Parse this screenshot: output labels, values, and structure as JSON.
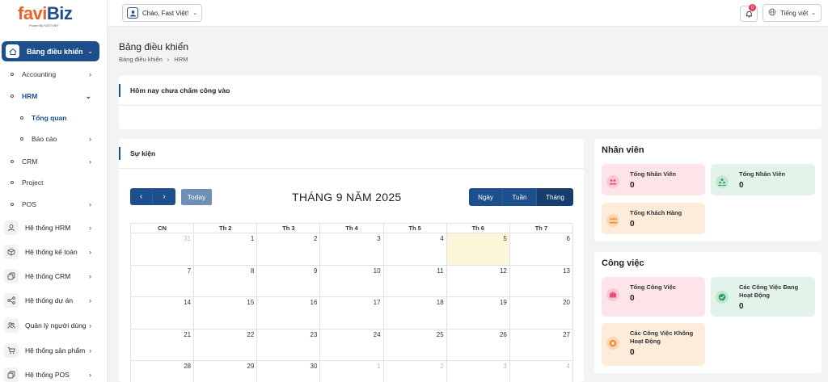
{
  "app": {
    "logo_part1": "favi",
    "logo_part2": "Biz",
    "logo_sub": "Power By FASTVIET"
  },
  "header": {
    "greeting": "Chào, Fast Việt!",
    "notification_count": "0",
    "language": "Tiếng việt"
  },
  "sidebar": {
    "dashboard": "Bảng điều khiển",
    "sub_items": [
      {
        "label": "Accounting"
      },
      {
        "label": "HRM"
      },
      {
        "label": "Tổng quan"
      },
      {
        "label": "Báo cáo"
      },
      {
        "label": "CRM"
      },
      {
        "label": "Project"
      },
      {
        "label": "POS"
      }
    ],
    "systems": [
      {
        "label": "Hệ thống HRM",
        "icon": "user-icon"
      },
      {
        "label": "Hệ thống kế toán",
        "icon": "box-icon"
      },
      {
        "label": "Hệ thống CRM",
        "icon": "copy-icon"
      },
      {
        "label": "Hệ thống dự án",
        "icon": "share-icon"
      },
      {
        "label": "Quản lý người dùng",
        "icon": "users-icon"
      },
      {
        "label": "Hệ thống sản phẩm",
        "icon": "cart-icon"
      },
      {
        "label": "Hệ thống POS",
        "icon": "copy-icon"
      }
    ]
  },
  "page": {
    "title": "Bảng điều khiển",
    "breadcrumb": [
      "Bảng điều khiển",
      "HRM"
    ],
    "checkin_message": "Hôm nay chưa chấm công vào"
  },
  "events": {
    "title": "Sự kiện",
    "today_label": "Today",
    "month_title": "THÁNG 9 NĂM 2025",
    "views": [
      "Ngày",
      "Tuần",
      "Tháng"
    ],
    "active_view": "Tháng",
    "weekdays": [
      "CN",
      "Th 2",
      "Th 3",
      "Th 4",
      "Th 5",
      "Th 6",
      "Th 7"
    ],
    "weeks": [
      [
        "31",
        "1",
        "2",
        "3",
        "4",
        "5",
        "6"
      ],
      [
        "7",
        "8",
        "9",
        "10",
        "11",
        "12",
        "13"
      ],
      [
        "14",
        "15",
        "16",
        "17",
        "18",
        "19",
        "20"
      ],
      [
        "21",
        "22",
        "23",
        "24",
        "25",
        "26",
        "27"
      ],
      [
        "28",
        "29",
        "30",
        "1",
        "2",
        "3",
        "4"
      ]
    ]
  },
  "staff": {
    "title": "Nhân viên",
    "stats": [
      {
        "label": "Tổng Nhân Viên",
        "value": "0",
        "color": "#e84f73"
      },
      {
        "label": "Tổng Nhân Viên",
        "value": "0",
        "color": "#2e9e5f"
      },
      {
        "label": "Tổng Khách Hàng",
        "value": "0",
        "color": "#f08c2e"
      }
    ]
  },
  "work": {
    "title": "Công việc",
    "stats": [
      {
        "label": "Tổng Công Việc",
        "value": "0",
        "color": "#e84f73"
      },
      {
        "label": "Các Công Việc Đang Hoạt Động",
        "value": "0",
        "color": "#2e9e5f"
      },
      {
        "label": "Các Công Việc Không Hoạt Động",
        "value": "0",
        "color": "#f08c2e"
      }
    ]
  }
}
